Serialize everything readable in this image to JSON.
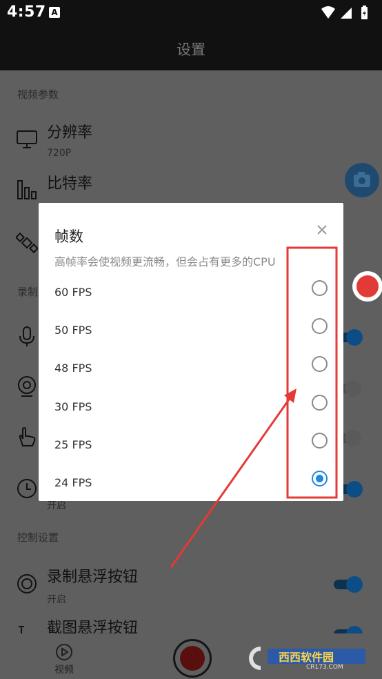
{
  "status_bar": {
    "time": "4:57",
    "notification_icon": "A"
  },
  "app_bar": {
    "title": "设置"
  },
  "settings": {
    "video_section": "视频参数",
    "resolution": {
      "title": "分辨率",
      "value": "720P"
    },
    "bitrate": {
      "title": "比特率"
    },
    "record_section_partial": "录制",
    "timer_value": "开启",
    "control_section": "控制设置",
    "record_float": {
      "title": "录制悬浮按钮",
      "value": "开启"
    },
    "screenshot_float": {
      "title": "截图悬浮按钮"
    }
  },
  "bottom_nav": {
    "video_label": "视频"
  },
  "dialog": {
    "title": "帧数",
    "subtitle": "高帧率会使视频更流畅，但会占有更多的CPU",
    "options": [
      {
        "label": "60 FPS",
        "selected": false
      },
      {
        "label": "50 FPS",
        "selected": false
      },
      {
        "label": "48 FPS",
        "selected": false
      },
      {
        "label": "30 FPS",
        "selected": false
      },
      {
        "label": "25 FPS",
        "selected": false
      },
      {
        "label": "24 FPS",
        "selected": true
      }
    ]
  },
  "watermark": {
    "text": "西西软件园",
    "domain": "CR173.COM"
  },
  "colors": {
    "accent": "#1e88e5",
    "annotation": "#e53935",
    "record_red": "#e23a37"
  }
}
